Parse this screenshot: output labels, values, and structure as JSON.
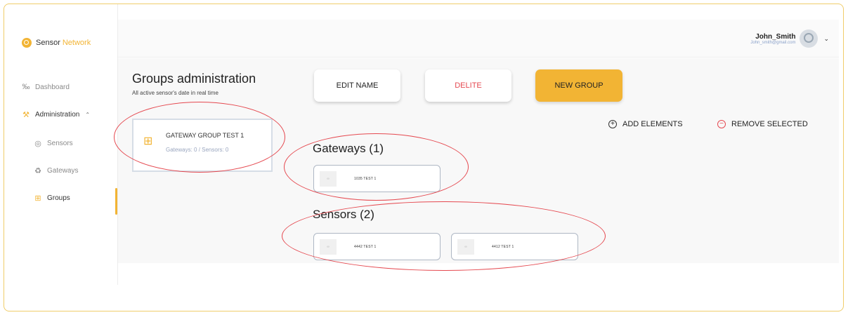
{
  "app": {
    "logo_text": "Sensor",
    "logo_accent": "Network"
  },
  "sidebar": {
    "items": [
      {
        "label": "Dashboard",
        "icon": "sensor-pin-icon"
      },
      {
        "label": "Administration",
        "icon": "wrench-icon"
      },
      {
        "label": "Sensors",
        "icon": "sensor-icon"
      },
      {
        "label": "Gateways",
        "icon": "gateway-icon"
      },
      {
        "label": "Groups",
        "icon": "groups-icon"
      }
    ]
  },
  "user": {
    "name": "John_Smith",
    "email": "John_smith@gmail.com"
  },
  "page": {
    "title": "Groups administration",
    "subtitle": "All active sensor's date in real time"
  },
  "toolbar": {
    "edit_label": "EDIT NAME",
    "delete_label": "DELITE",
    "new_label": "NEW GROUP"
  },
  "actions": {
    "add_label": "ADD ELEMENTS",
    "remove_label": "REMOVE SELECTED"
  },
  "group": {
    "name": "GATEWAY GROUP TEST 1",
    "counts": "Gateways: 0 / Sensors: 0"
  },
  "gateways": {
    "title": "Gateways (1)",
    "items": [
      {
        "label": "1035 TEST 1"
      }
    ]
  },
  "sensors": {
    "title": "Sensors (2)",
    "items": [
      {
        "label": "4442 TEST 1"
      },
      {
        "label": "4412 TEST 1"
      }
    ]
  },
  "colors": {
    "accent": "#f2b434",
    "danger": "#e54a52",
    "annotation": "#e5484f"
  }
}
